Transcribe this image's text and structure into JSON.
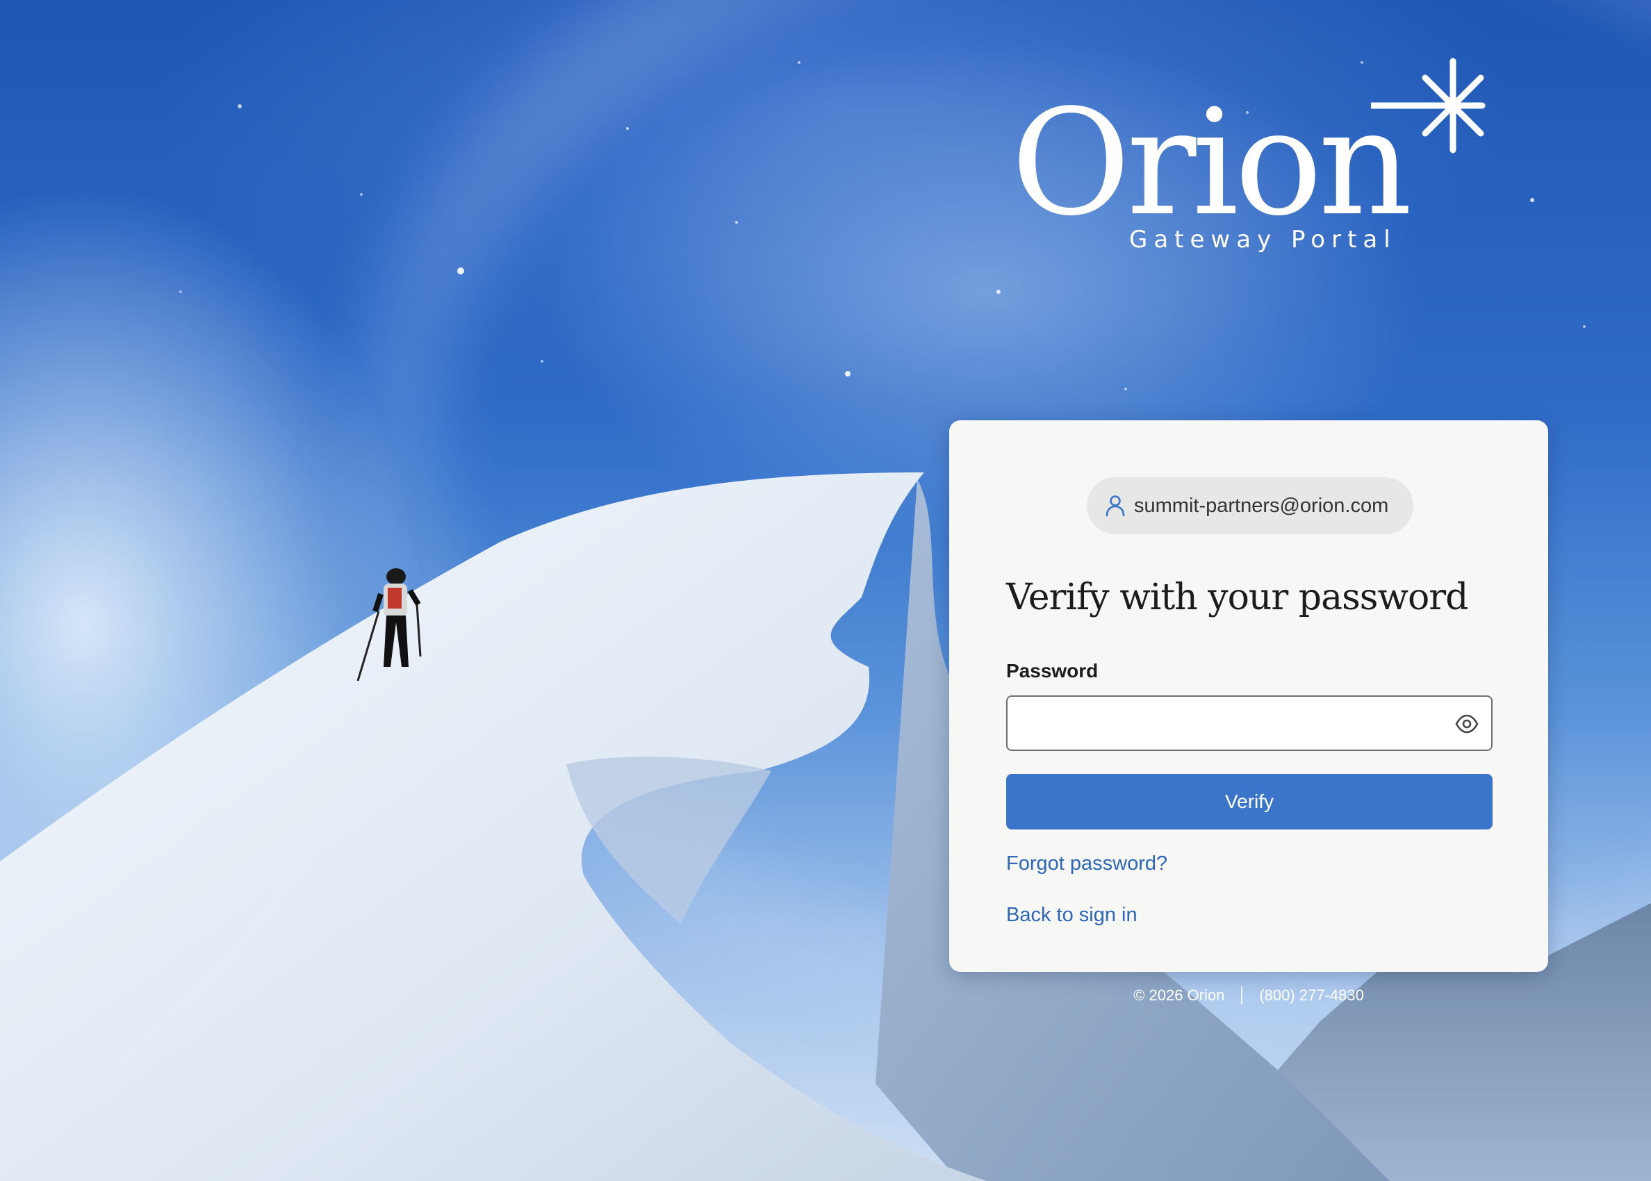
{
  "brand": {
    "name": "Orion",
    "subtitle": "Gateway Portal"
  },
  "card": {
    "user_email": "summit-partners@orion.com",
    "heading": "Verify with your password",
    "password_label": "Password",
    "password_value": "",
    "verify_label": "Verify",
    "forgot_label": "Forgot password?",
    "back_label": "Back to sign in"
  },
  "footer": {
    "copyright": "© 2026 Orion",
    "phone": "(800) 277-4830"
  },
  "icons": {
    "user": "user-icon",
    "eye": "eye-icon",
    "star": "sparkle-star-icon"
  },
  "colors": {
    "accent": "#3a75c9",
    "link": "#2f67b8",
    "card_bg": "#f7f7f5"
  }
}
